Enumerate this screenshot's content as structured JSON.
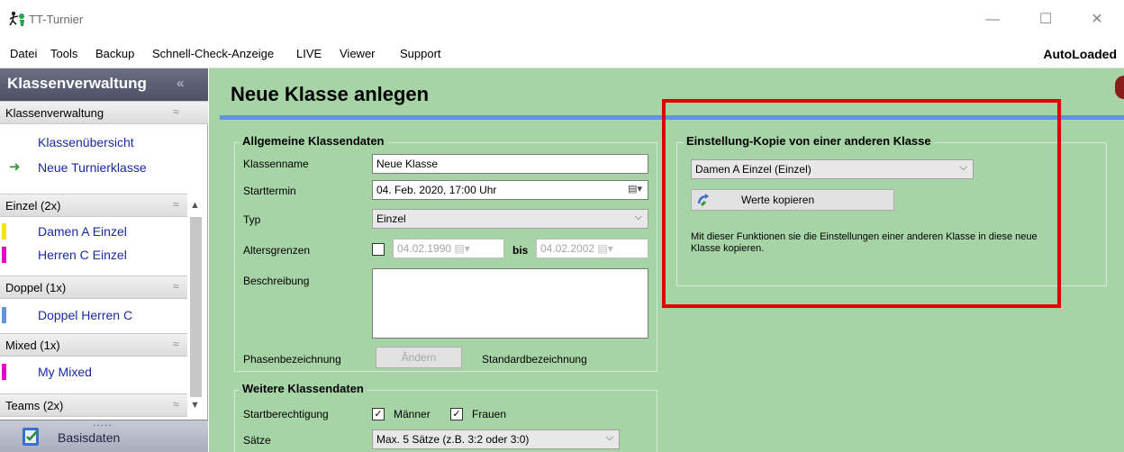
{
  "window": {
    "title": "TT-Turnier",
    "minimize": "—",
    "maximize": "☐",
    "close": "✕"
  },
  "menu": {
    "items": [
      "Datei",
      "Tools",
      "Backup",
      "Schnell-Check-Anzeige",
      "LIVE",
      "Viewer",
      "Support"
    ],
    "right_label": "AutoLoaded"
  },
  "sidebar": {
    "header": "Klassenverwaltung",
    "collapse_glyph": "«",
    "sections": [
      {
        "title": "Klassenverwaltung",
        "items": [
          "Klassenübersicht",
          "Neue Turnierklasse"
        ]
      },
      {
        "title": "Einzel (2x)",
        "items": [
          "Damen A Einzel",
          "Herren C Einzel"
        ]
      },
      {
        "title": "Doppel (1x)",
        "items": [
          "Doppel Herren C"
        ]
      },
      {
        "title": "Mixed (1x)",
        "items": [
          "My Mixed"
        ]
      },
      {
        "title": "Teams (2x)",
        "items": []
      }
    ],
    "group_toggle": "≈",
    "active_item_marker": "➜",
    "bottom_button": "Basisdaten",
    "bottom_dots": "....."
  },
  "main": {
    "page_title": "Neue Klasse anlegen",
    "general": {
      "legend": "Allgemeine Klassendaten",
      "labels": {
        "name": "Klassenname",
        "start": "Starttermin",
        "type": "Typ",
        "age": "Altersgrenzen",
        "desc": "Beschreibung",
        "phase": "Phasenbezeichnung"
      },
      "name_value": "Neue Klasse",
      "start_value": "04. Feb. 2020, 17:00 Uhr",
      "type_value": "Einzel",
      "age_from": "04.02.1990",
      "age_to_label": "bis",
      "age_to": "04.02.2002",
      "phase_button": "Ändern",
      "phase_value": "Standardbezeichnung"
    },
    "further": {
      "legend": "Weitere Klassendaten",
      "labels": {
        "eligibility": "Startberechtigung",
        "sets": "Sätze"
      },
      "men_label": "Männer",
      "women_label": "Frauen",
      "sets_value": "Max. 5 Sätze (z.B. 3:2 oder 3:0)"
    },
    "copy": {
      "legend": "Einstellung-Kopie von einer anderen Klasse",
      "source_value": "Damen A Einzel (Einzel)",
      "copy_button": "Werte kopieren",
      "help_text": "Mit dieser Funktionen sie die Einstellungen einer anderen Klasse in diese neue Klasse kopieren."
    }
  },
  "colors": {
    "main_bg": "#a6d4a6",
    "accent_rule": "#5f96d9",
    "highlight_box": "#e00000",
    "class_bars": [
      "#f2e600",
      "#e000c8",
      "#5f96d9",
      "#e000c8"
    ]
  }
}
